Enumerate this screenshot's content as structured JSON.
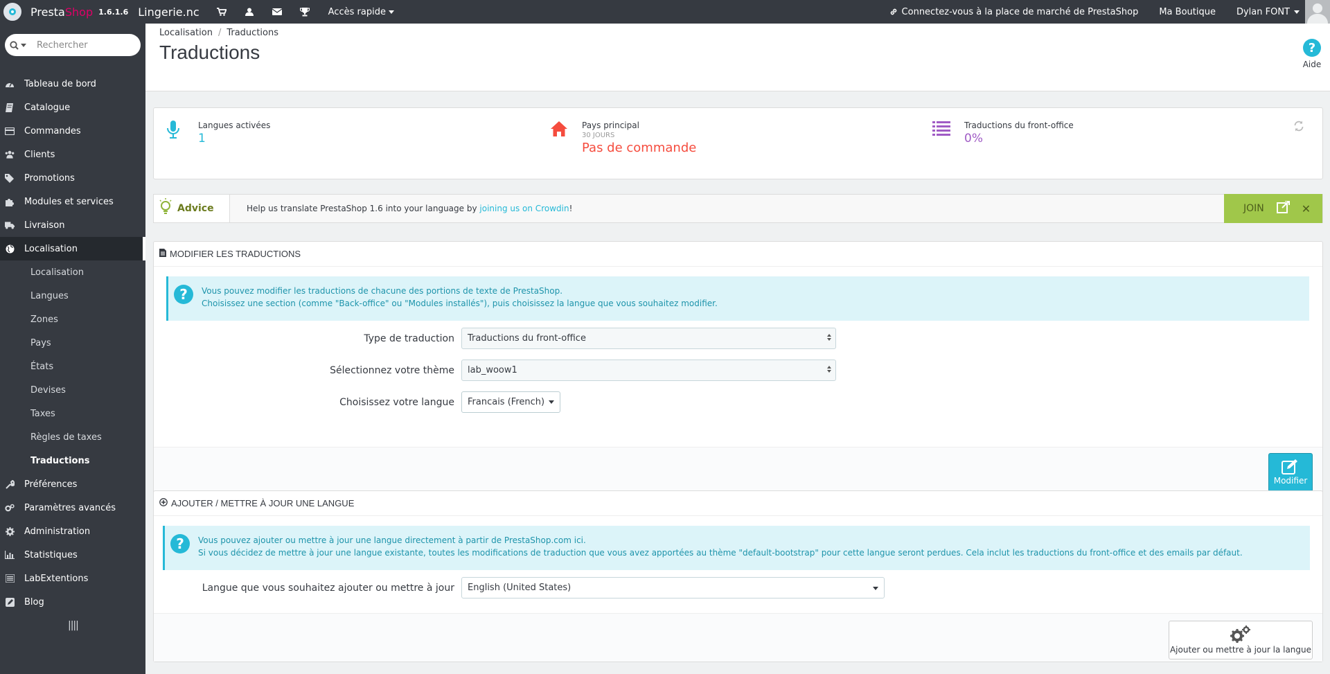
{
  "topbar": {
    "brand_part1": "Presta",
    "brand_part2": "Shop",
    "version": "1.6.1.6",
    "shop_name": "Lingerie.nc",
    "quick_access": "Accès rapide",
    "marketplace": "Connectez-vous à la place de marché de PrestaShop",
    "my_shop": "Ma Boutique",
    "user": "Dylan FONT"
  },
  "search": {
    "placeholder": "Rechercher"
  },
  "sidebar": {
    "items": [
      {
        "label": "Tableau de bord",
        "icon": "dashboard-icon"
      },
      {
        "label": "Catalogue",
        "icon": "book-icon"
      },
      {
        "label": "Commandes",
        "icon": "credit-card-icon"
      },
      {
        "label": "Clients",
        "icon": "users-icon"
      },
      {
        "label": "Promotions",
        "icon": "tags-icon"
      },
      {
        "label": "Modules et services",
        "icon": "puzzle-icon"
      },
      {
        "label": "Livraison",
        "icon": "truck-icon"
      },
      {
        "label": "Localisation",
        "icon": "globe-icon"
      }
    ],
    "sub_items": [
      "Localisation",
      "Langues",
      "Zones",
      "Pays",
      "États",
      "Devises",
      "Taxes",
      "Règles de taxes",
      "Traductions"
    ],
    "items_after": [
      {
        "label": "Préférences",
        "icon": "wrench-icon"
      },
      {
        "label": "Paramètres avancés",
        "icon": "cogs-icon"
      },
      {
        "label": "Administration",
        "icon": "gear-icon"
      },
      {
        "label": "Statistiques",
        "icon": "bar-chart-icon"
      },
      {
        "label": "LabExtentions",
        "icon": "list-icon"
      },
      {
        "label": "Blog",
        "icon": "pencil-square-icon"
      }
    ]
  },
  "header": {
    "breadcrumb_1": "Localisation",
    "breadcrumb_sep": "/",
    "breadcrumb_2": "Traductions",
    "title": "Traductions",
    "help": "Aide"
  },
  "kpi": {
    "languages_title": "Langues activées",
    "languages_value": "1",
    "country_title": "Pays principal",
    "country_sub": "30 JOURS",
    "country_value": "Pas de commande",
    "front_title": "Traductions du front-office",
    "front_value": "0%"
  },
  "advice": {
    "label": "Advice",
    "text_before": "Help us translate PrestaShop 1.6 into your language by ",
    "link": "joining us on Crowdin",
    "text_after": "!",
    "join": "JOIN"
  },
  "modify_panel": {
    "title": "MODIFIER LES TRADUCTIONS",
    "info_line1": "Vous pouvez modifier les traductions de chacune des portions de texte de PrestaShop.",
    "info_line2": "Choisissez une section (comme \"Back-office\" ou \"Modules installés\"), puis choisissez la langue que vous souhaitez modifier.",
    "type_label": "Type de traduction",
    "type_value": "Traductions du front-office",
    "theme_label": "Sélectionnez votre thème",
    "theme_value": "lab_woow1",
    "lang_label": "Choisissez votre langue",
    "lang_value": "Francais (French)",
    "button": "Modifier"
  },
  "add_panel": {
    "title": "AJOUTER / METTRE À JOUR UNE LANGUE",
    "info_line1": "Vous pouvez ajouter ou mettre à jour une langue directement à partir de PrestaShop.com ici.",
    "info_line2": "Si vous décidez de mettre à jour une langue existante, toutes les modifications de traduction que vous avez apportées au thème \"default-bootstrap\" pour cette langue seront perdues. Cela inclut les traductions du front-office et des emails par défaut.",
    "lang_label": "Langue que vous souhaitez ajouter ou mettre à jour",
    "lang_value": "English (United States)",
    "button": "Ajouter ou mettre à jour la langue"
  },
  "colors": {
    "accent": "#25b9d7",
    "danger": "#f54c3e",
    "purple": "#a05cc5",
    "sidebar": "#363a41",
    "advice_green": "#a0c74a"
  }
}
